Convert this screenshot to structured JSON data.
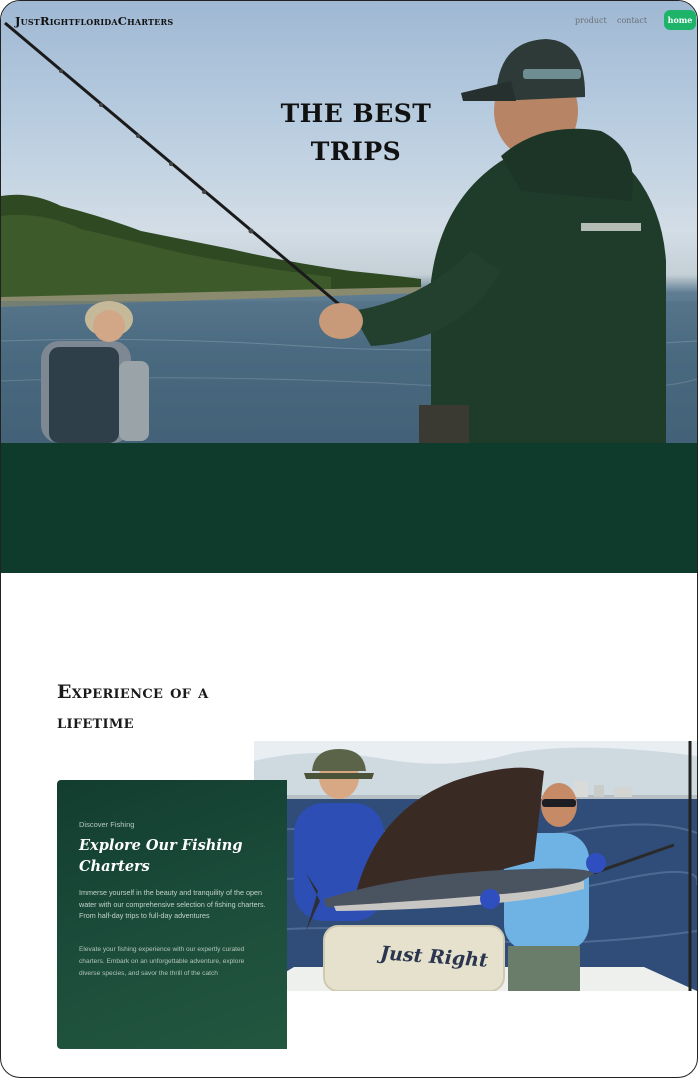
{
  "nav": {
    "logo": "JustRightfloridaCharters",
    "links": [
      "product",
      "contact"
    ],
    "home_label": "home"
  },
  "hero": {
    "title_line1": "THE BEST",
    "title_line2": "TRIPS"
  },
  "experience": {
    "heading_line1": "Experience of a",
    "heading_line2": "lifetime"
  },
  "card": {
    "kicker": "Discover Fishing",
    "title": "Explore Our Fishing Charters",
    "paragraph1": "Immerse yourself in the beauty and tranquility of the open water with our comprehensive selection of fishing charters. From half-day trips to full-day adventures",
    "paragraph2": "Elevate your fishing experience with our expertly curated charters. Embark on an unforgettable adventure, explore diverse species, and savor the thrill of the catch"
  },
  "photo": {
    "boat_text": "Just Right"
  },
  "colors": {
    "brand_green": "#0e3b2c",
    "home_button": "#1db46a"
  }
}
